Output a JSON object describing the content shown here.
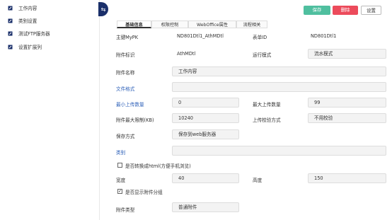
{
  "sidebar": {
    "items": [
      {
        "label": "工作内容",
        "icon": "edit-icon"
      },
      {
        "label": "类别设置",
        "icon": "edit-icon"
      },
      {
        "label": "测试FTP服务器",
        "icon": "edit-icon"
      },
      {
        "label": "设置扩展列",
        "icon": "edit-icon"
      }
    ],
    "toggle_glyph": "⇆"
  },
  "tabs": [
    {
      "label": "基础信息",
      "active": true
    },
    {
      "label": "权限控制",
      "active": false
    },
    {
      "label": "WebOffice属性",
      "active": false
    },
    {
      "label": "流程相关",
      "active": false
    }
  ],
  "toolbar": {
    "save_label": "保存",
    "delete_label": "删除",
    "settings_label": "设置"
  },
  "form": {
    "pk_label": "主键MyPK",
    "pk_value": "ND801Dtl1_AthMDtl",
    "table_label": "表单ID",
    "table_value": "ND801Dtl1",
    "attach_id_label": "附件标识",
    "attach_id_value": "AthMDtl",
    "run_mode_label": "运行模式",
    "run_mode_value": "流水模式",
    "attach_name_label": "附件名称",
    "attach_name_value": "工作内容",
    "file_format_label": "文件格式",
    "file_format_value": "",
    "min_upload_label": "最小上传数量",
    "min_upload_value": "0",
    "max_upload_label": "最大上传数量",
    "max_upload_value": "99",
    "max_size_label": "附件最大限制(KB)",
    "max_size_value": "10240",
    "check_mode_label": "上传校验方式",
    "check_mode_value": "不用校验",
    "save_mode_label": "保存方式",
    "save_mode_value": "保存到web服务器",
    "category_label": "类别",
    "category_value": "",
    "html_convert_label": "是否转换成html(方便手机浏览)",
    "html_convert_checked": "",
    "width_label": "宽度",
    "width_value": "40",
    "height_label": "高度",
    "height_value": "150",
    "show_group_label": "是否显示附件分组",
    "show_group_checked": "✓",
    "attach_type_label": "附件类型",
    "attach_type_value": "普通附件"
  }
}
